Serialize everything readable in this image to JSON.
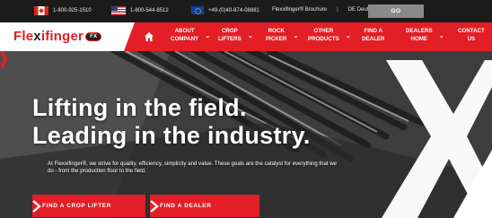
{
  "topbar": {
    "phone_ca": "1-800-925-1510",
    "phone_us": "1-800-544-8512",
    "phone_eu": "+49-(0)40-874-08881",
    "brochure": "Flexxifinger® Brochure",
    "separator": "|",
    "language": "DE Deutsch",
    "go": "GO",
    "icons": [
      "flag-ca-icon",
      "flag-us-icon",
      "flag-eu-icon",
      "chevron-down-icon"
    ]
  },
  "nav": {
    "logo_text_red": "Fle",
    "logo_text_x": "x",
    "logo_text_rest": "ifinger",
    "logo_badge": "FX",
    "items": [
      {
        "label_line1": "ABOUT",
        "label_line2": "COMPANY"
      },
      {
        "label_line1": "CROP",
        "label_line2": "LIFTERS"
      },
      {
        "label_line1": "ROCK",
        "label_line2": "PICKER"
      },
      {
        "label_line1": "OTHER",
        "label_line2": "PRODUCTS"
      },
      {
        "label_line1": "FIND A",
        "label_line2": "DEALER"
      },
      {
        "label_line1": "DEALERS",
        "label_line2": "HOME"
      },
      {
        "label_line1": "CONTACT",
        "label_line2": "US"
      }
    ],
    "chevron": "⌄"
  },
  "hero": {
    "headline_line1": "Lifting in the field.",
    "headline_line2": "Leading in the industry.",
    "subtext": "At Flexxifinger®, we strive for quality, efficiency, simplicity and value. These goals are the catalyst for everything that we do - from the production floor to the field.",
    "cta_crop": "FIND A CROP LIFTER",
    "cta_dealer": "FIND A DEALER"
  },
  "colors": {
    "brand_red": "#e41e26",
    "topbar_bg": "#1b1b1b",
    "go_button": "#8a8a8a"
  }
}
